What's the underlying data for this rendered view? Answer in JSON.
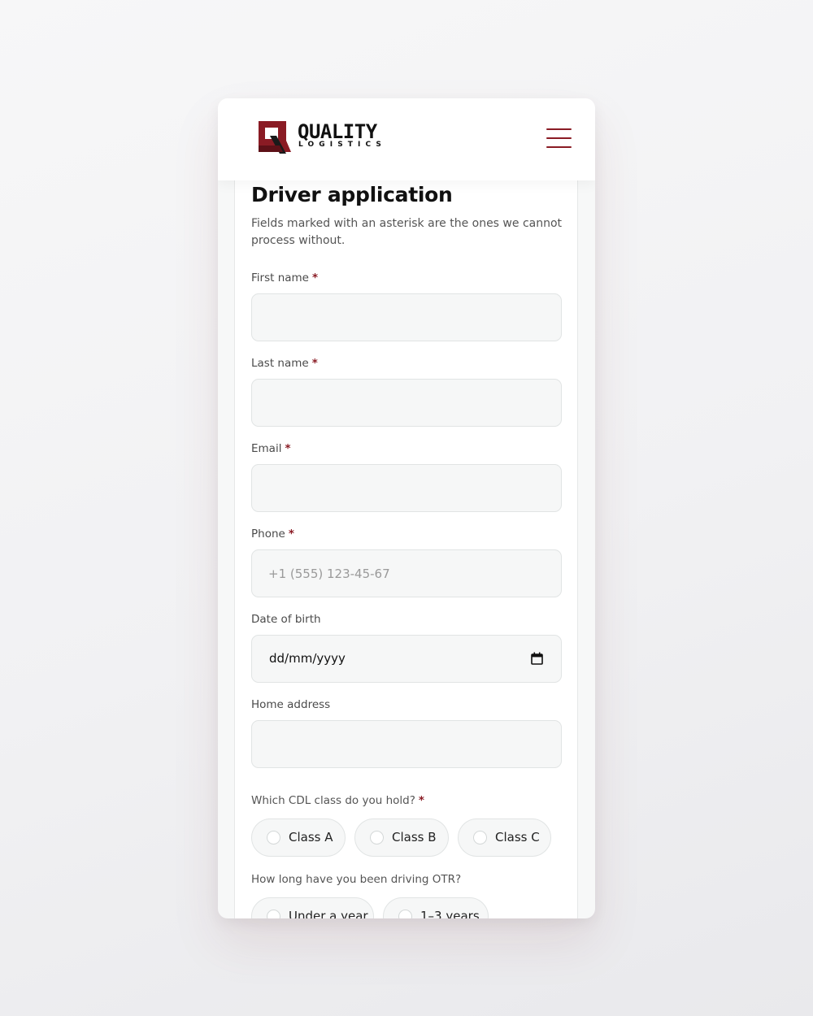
{
  "brand": {
    "name": "QUALITY",
    "tagline": "LOGISTICS",
    "accent_color": "#8a1b24"
  },
  "header": {
    "menu_icon": "hamburger-menu-icon"
  },
  "form": {
    "title": "Driver application",
    "intro": "Fields marked with an asterisk are the ones we cannot process without.",
    "required_marker": "*",
    "first_name": {
      "label": "First name",
      "value": "",
      "placeholder": ""
    },
    "last_name": {
      "label": "Last name",
      "value": "",
      "placeholder": ""
    },
    "email": {
      "label": "Email",
      "value": "",
      "placeholder": ""
    },
    "phone": {
      "label": "Phone",
      "value": "",
      "placeholder": "+1 (555) 123-45-67"
    },
    "dob": {
      "label": "Date of birth",
      "value": "dd/mm/yyyy",
      "icon": "calendar-icon"
    },
    "home_address": {
      "label": "Home address",
      "value": "",
      "placeholder": ""
    },
    "cdl": {
      "question": "Which CDL class do you hold?",
      "options": [
        "Class A",
        "Class B",
        "Class C"
      ]
    },
    "otr": {
      "question": "How long have you been driving OTR?",
      "options": [
        "Under a year",
        "1–3 years"
      ]
    }
  }
}
